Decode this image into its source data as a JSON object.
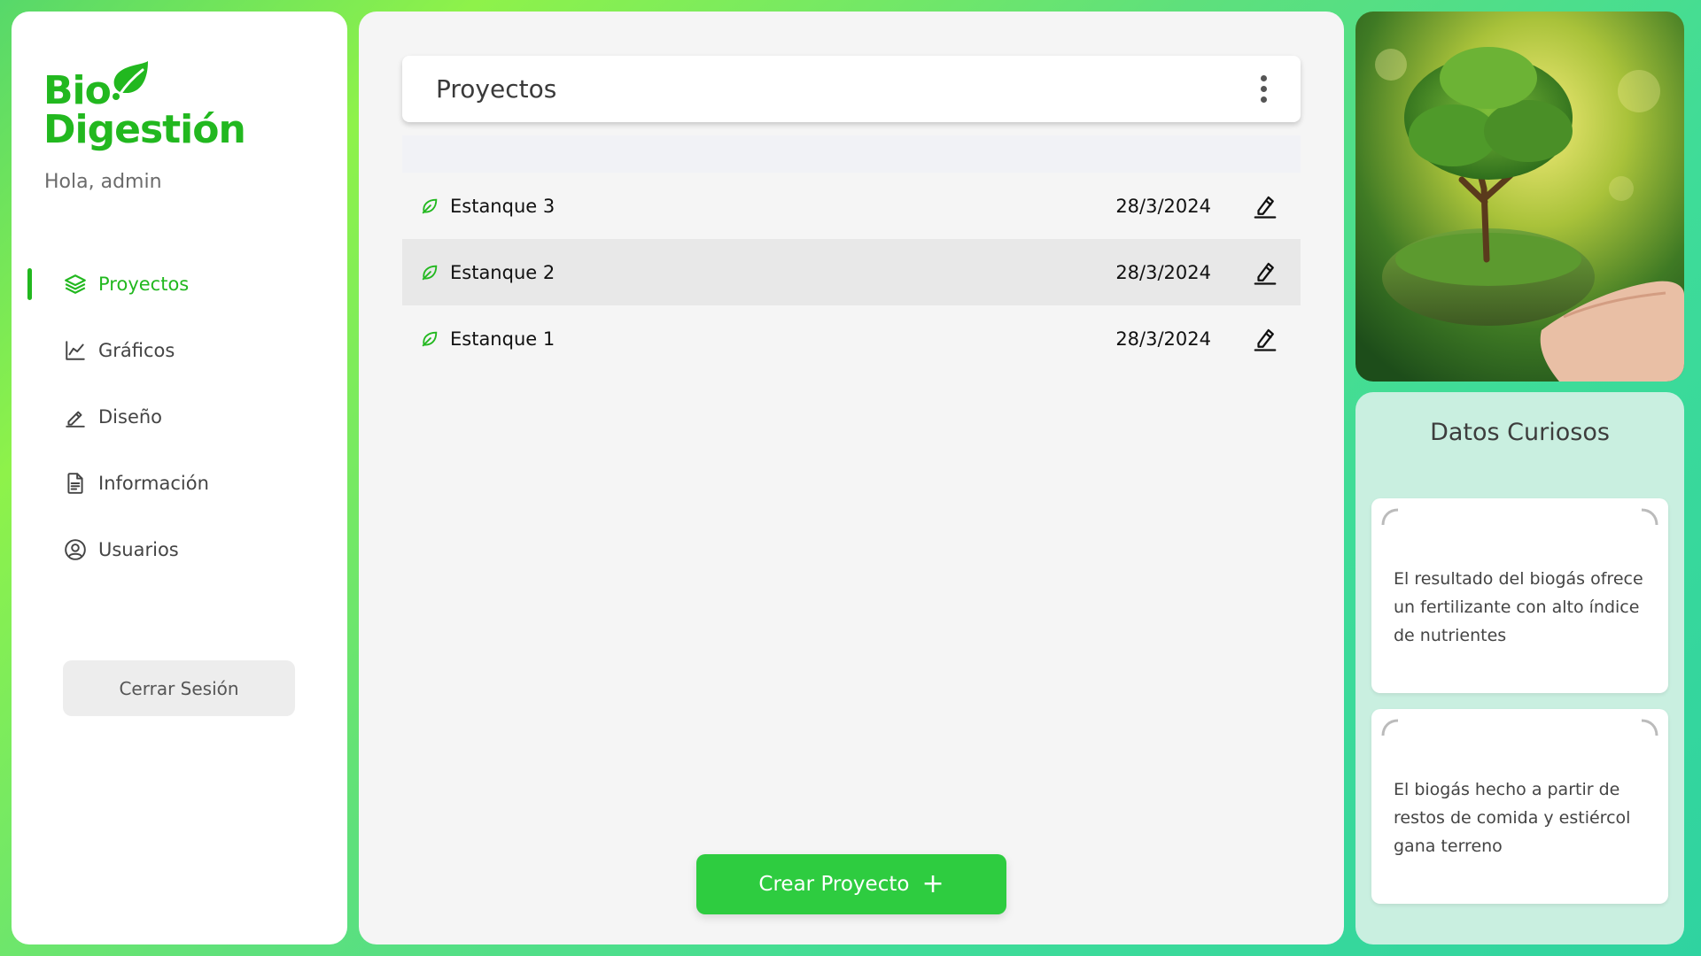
{
  "brand": {
    "line1": "Bio",
    "line2": "Digestión",
    "greeting": "Hola, admin",
    "accent_color": "#22b81f"
  },
  "sidebar": {
    "items": [
      {
        "label": "Proyectos",
        "icon": "layers-icon",
        "active": true
      },
      {
        "label": "Gráficos",
        "icon": "line-chart-icon",
        "active": false
      },
      {
        "label": "Diseño",
        "icon": "pencil-icon",
        "active": false
      },
      {
        "label": "Información",
        "icon": "document-icon",
        "active": false
      },
      {
        "label": "Usuarios",
        "icon": "user-circle-icon",
        "active": false
      }
    ],
    "logout_label": "Cerrar Sesión"
  },
  "main": {
    "title": "Proyectos",
    "menu_icon": "kebab-menu-icon",
    "projects": [
      {
        "name": "Estanque 3",
        "date": "28/3/2024"
      },
      {
        "name": "Estanque 2",
        "date": "28/3/2024"
      },
      {
        "name": "Estanque 1",
        "date": "28/3/2024"
      }
    ],
    "create_label": "Crear Proyecto",
    "create_icon": "+",
    "button_color": "#2ecc40"
  },
  "facts": {
    "title": "Datos Curiosos",
    "cards": [
      {
        "text": "El resultado del biogás ofrece un fertilizante con alto índice de nutrientes"
      },
      {
        "text": "El biogás hecho a partir de restos de comida y estiércol gana terreno"
      }
    ]
  }
}
